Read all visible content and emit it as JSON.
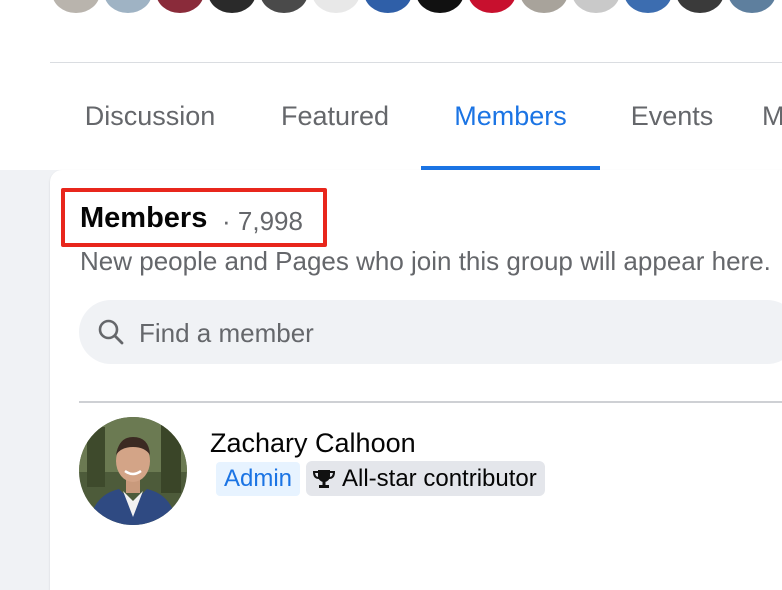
{
  "tabs": [
    {
      "label": "Discussion",
      "active": false
    },
    {
      "label": "Featured",
      "active": false
    },
    {
      "label": "Members",
      "active": true
    },
    {
      "label": "Events",
      "active": false
    },
    {
      "label": "M",
      "active": false
    }
  ],
  "members_section": {
    "title": "Members",
    "count_text": "· 7,998",
    "subtitle": "New people and Pages who join this group will appear here."
  },
  "search": {
    "placeholder": "Find a member",
    "icon": "search-icon"
  },
  "member": {
    "name": "Zachary Calhoon",
    "role_badge": "Admin",
    "contributor_badge": "All-star contributor",
    "badge_icon": "trophy-icon"
  },
  "colors": {
    "accent": "#1b74e4",
    "highlight": "#e8261c",
    "muted_text": "#65676b",
    "page_bg": "#f0f2f5"
  }
}
